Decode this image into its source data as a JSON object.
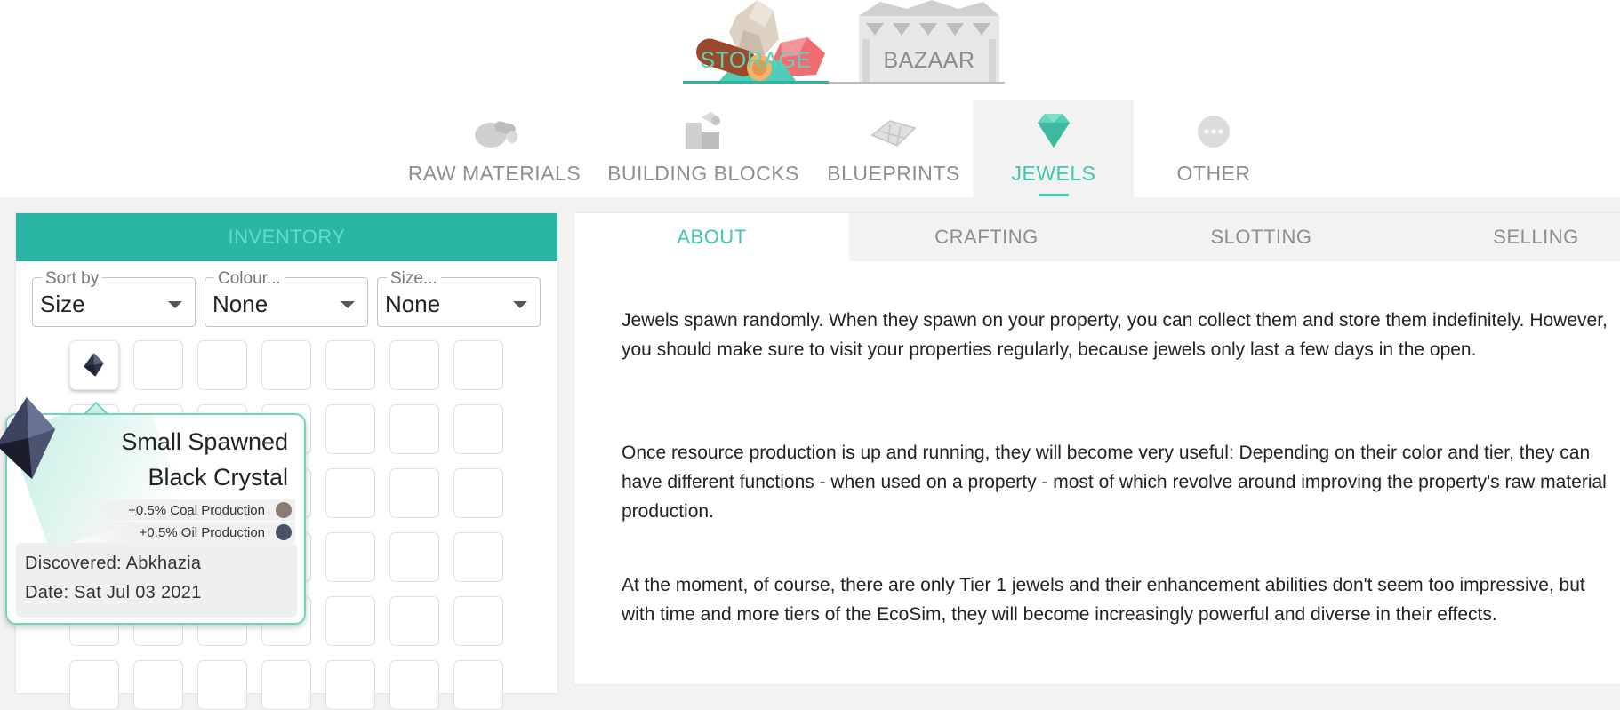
{
  "header": {
    "tabs": [
      {
        "label": "STORAGE",
        "active": true
      },
      {
        "label": "BAZAAR",
        "active": false
      }
    ]
  },
  "categories": [
    {
      "label": "RAW MATERIALS",
      "icon": "raw-materials-icon",
      "active": false
    },
    {
      "label": "BUILDING BLOCKS",
      "icon": "building-blocks-icon",
      "active": false
    },
    {
      "label": "BLUEPRINTS",
      "icon": "blueprint-icon",
      "active": false
    },
    {
      "label": "JEWELS",
      "icon": "diamond-icon",
      "active": true
    },
    {
      "label": "OTHER",
      "icon": "more-icon",
      "active": false
    }
  ],
  "inventory": {
    "title": "INVENTORY",
    "filters": [
      {
        "legend": "Sort by",
        "value": "Size"
      },
      {
        "legend": "Colour...",
        "value": "None"
      },
      {
        "legend": "Size...",
        "value": "None"
      }
    ]
  },
  "tooltip": {
    "name_line1": "Small Spawned",
    "name_line2": "Black Crystal",
    "effects": [
      {
        "text": "+0.5%  Coal Production",
        "color": "#8b7b76"
      },
      {
        "text": "+0.5%  Oil Production",
        "color": "#4a5168"
      }
    ],
    "discovered": "Discovered: Abkhazia",
    "date": "Date: Sat Jul 03 2021"
  },
  "detail": {
    "tabs": [
      {
        "label": "ABOUT",
        "active": true
      },
      {
        "label": "CRAFTING",
        "active": false
      },
      {
        "label": "SLOTTING",
        "active": false
      },
      {
        "label": "SELLING",
        "active": false
      }
    ],
    "paragraphs": [
      "Jewels spawn randomly. When they spawn on your property, you can collect them and store them indefinitely. However, you should make sure to visit your properties regularly, because jewels only last a few days in the open.",
      "Once resource production is up and running, they will become very useful: Depending on their color and tier, they can have different functions - when used on a property - most of which revolve around improving the property's raw material production.",
      "At the moment, of course, there are only Tier 1 jewels and their enhancement abilities don't seem too impressive, but with time and more tiers of the EcoSim, they will become increasingly powerful and diverse in their effects."
    ]
  }
}
